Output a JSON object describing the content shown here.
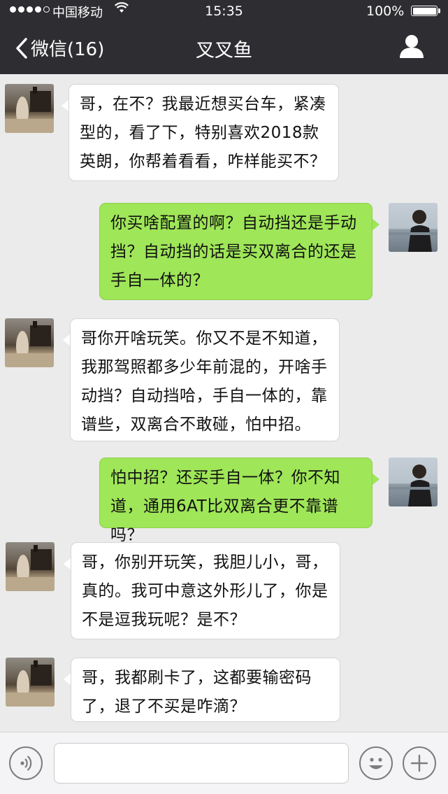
{
  "status_bar": {
    "carrier": "中国移动",
    "time": "15:35",
    "battery": "100%",
    "battery_level": 1.0,
    "signal_strength": "4 of 5"
  },
  "nav": {
    "back_label": "微信(16)",
    "title": "叉叉鱼"
  },
  "messages": [
    {
      "side": "in",
      "text": "哥，在不？我最近想买台车，紧凑型的，看了下，特别喜欢2018款英朗，你帮着看看，咋样能买不？"
    },
    {
      "side": "out",
      "text": "你买啥配置的啊？自动挡还是手动挡？自动挡的话是买双离合的还是手自一体的？"
    },
    {
      "side": "in",
      "text": "哥你开啥玩笑。你又不是不知道，我那驾照都多少年前混的，开啥手动挡？自动挡哈，手自一体的，靠谱些，双离合不敢碰，怕中招。"
    },
    {
      "side": "out",
      "text": "怕中招？还买手自一体？你不知道，通用6AT比双离合更不靠谱吗？"
    },
    {
      "side": "in",
      "text": "哥，你别开玩笑，我胆儿小，哥，真的。我可中意这外形儿了，你是不是逗我玩呢？是不？"
    },
    {
      "side": "in",
      "text": "哥，我都刷卡了，这都要输密码了，退了不买是咋滴？"
    }
  ],
  "input_bar": {
    "voice_icon": "voice-icon",
    "emoji_icon": "emoji-icon",
    "plus_icon": "plus-icon",
    "text_value": ""
  },
  "colors": {
    "nav_bg": "#2e2e32",
    "chat_bg": "#ebebeb",
    "incoming_bubble": "#ffffff",
    "outgoing_bubble": "#9fe658"
  }
}
